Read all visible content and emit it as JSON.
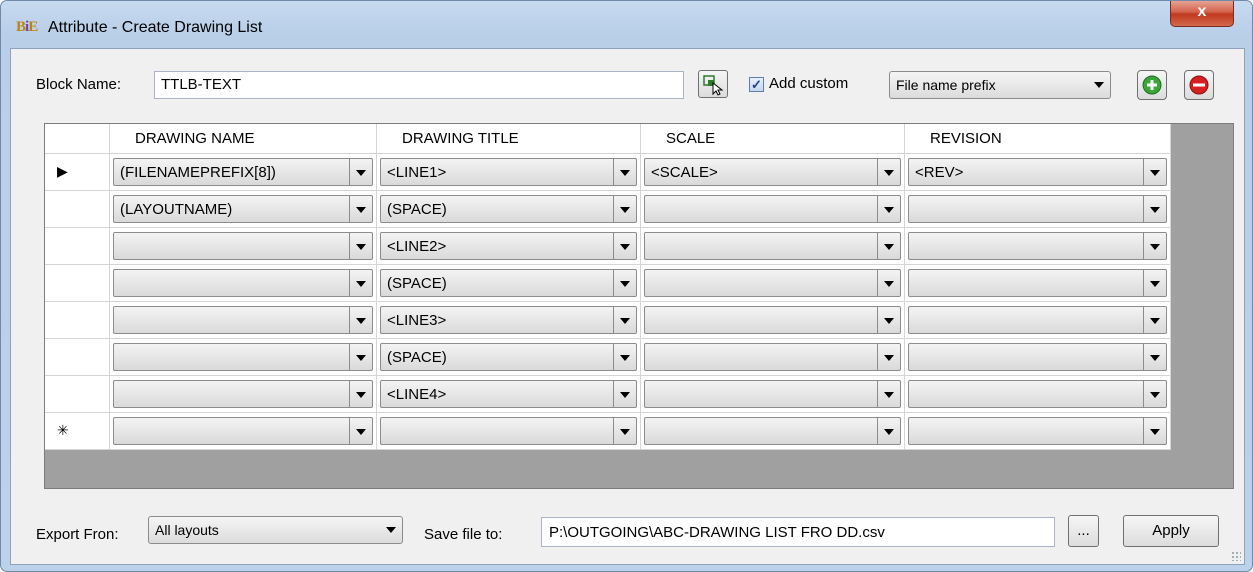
{
  "window": {
    "title": "Attribute - Create Drawing List",
    "icon": "bife-app-icon",
    "close_label": "x"
  },
  "block": {
    "label": "Block Name:",
    "value": "TTLB-TEXT"
  },
  "add_custom": {
    "label": "Add custom",
    "checked": true,
    "checkmark": "✓"
  },
  "custom_type": {
    "selected": "File name prefix"
  },
  "grid": {
    "columns": [
      "DRAWING NAME",
      "DRAWING TITLE",
      "SCALE",
      "REVISION"
    ],
    "row_markers": [
      "▶",
      "",
      "",
      "",
      "",
      "",
      "",
      "✳"
    ],
    "rows": [
      [
        "(FILENAMEPREFIX[8])",
        "<LINE1>",
        "<SCALE>",
        "<REV>"
      ],
      [
        "(LAYOUTNAME)",
        "(SPACE)",
        "",
        ""
      ],
      [
        "",
        "<LINE2>",
        "",
        ""
      ],
      [
        "",
        "(SPACE)",
        "",
        ""
      ],
      [
        "",
        "<LINE3>",
        "",
        ""
      ],
      [
        "",
        "(SPACE)",
        "",
        ""
      ],
      [
        "",
        "<LINE4>",
        "",
        ""
      ],
      [
        "",
        "",
        "",
        ""
      ]
    ]
  },
  "export": {
    "label": "Export Fron:",
    "selected": "All layouts"
  },
  "save": {
    "label": "Save file to:",
    "value": "P:\\OUTGOING\\ABC-DRAWING LIST FRO DD.csv",
    "browse_label": "...",
    "apply_label": "Apply"
  },
  "colors": {
    "add": "#3aa63a",
    "remove": "#d42020",
    "title_bg": "#bcd1ea"
  }
}
